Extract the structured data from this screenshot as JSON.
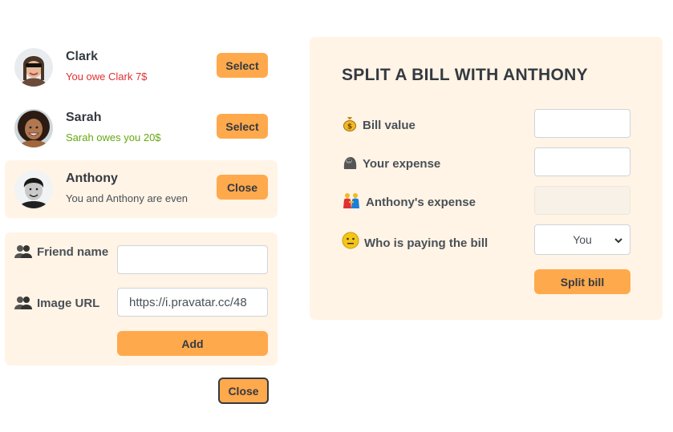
{
  "friends": [
    {
      "name": "Clark",
      "status": "You owe Clark 7$",
      "status_kind": "red",
      "button": "Select",
      "selected": false
    },
    {
      "name": "Sarah",
      "status": "Sarah owes you 20$",
      "status_kind": "green",
      "button": "Select",
      "selected": false
    },
    {
      "name": "Anthony",
      "status": "You and Anthony are even",
      "status_kind": "neutral",
      "button": "Close",
      "selected": true
    }
  ],
  "add_form": {
    "friend_name_label": "Friend name",
    "friend_name_value": "",
    "image_url_label": "Image URL",
    "image_url_value": "https://i.pravatar.cc/48",
    "add_button": "Add"
  },
  "close_button": "Close",
  "split_form": {
    "title": "SPLIT A BILL WITH ANTHONY",
    "bill_value_label": "Bill value",
    "your_expense_label": "Your expense",
    "friend_expense_label": "Anthony's expense",
    "payer_label": "Who is paying the bill",
    "payer_selected": "You",
    "submit_button": "Split bill"
  },
  "colors": {
    "accent": "#ffa94d",
    "panel": "#fff4e6",
    "owe": "#e03131",
    "owed": "#66a80f"
  }
}
